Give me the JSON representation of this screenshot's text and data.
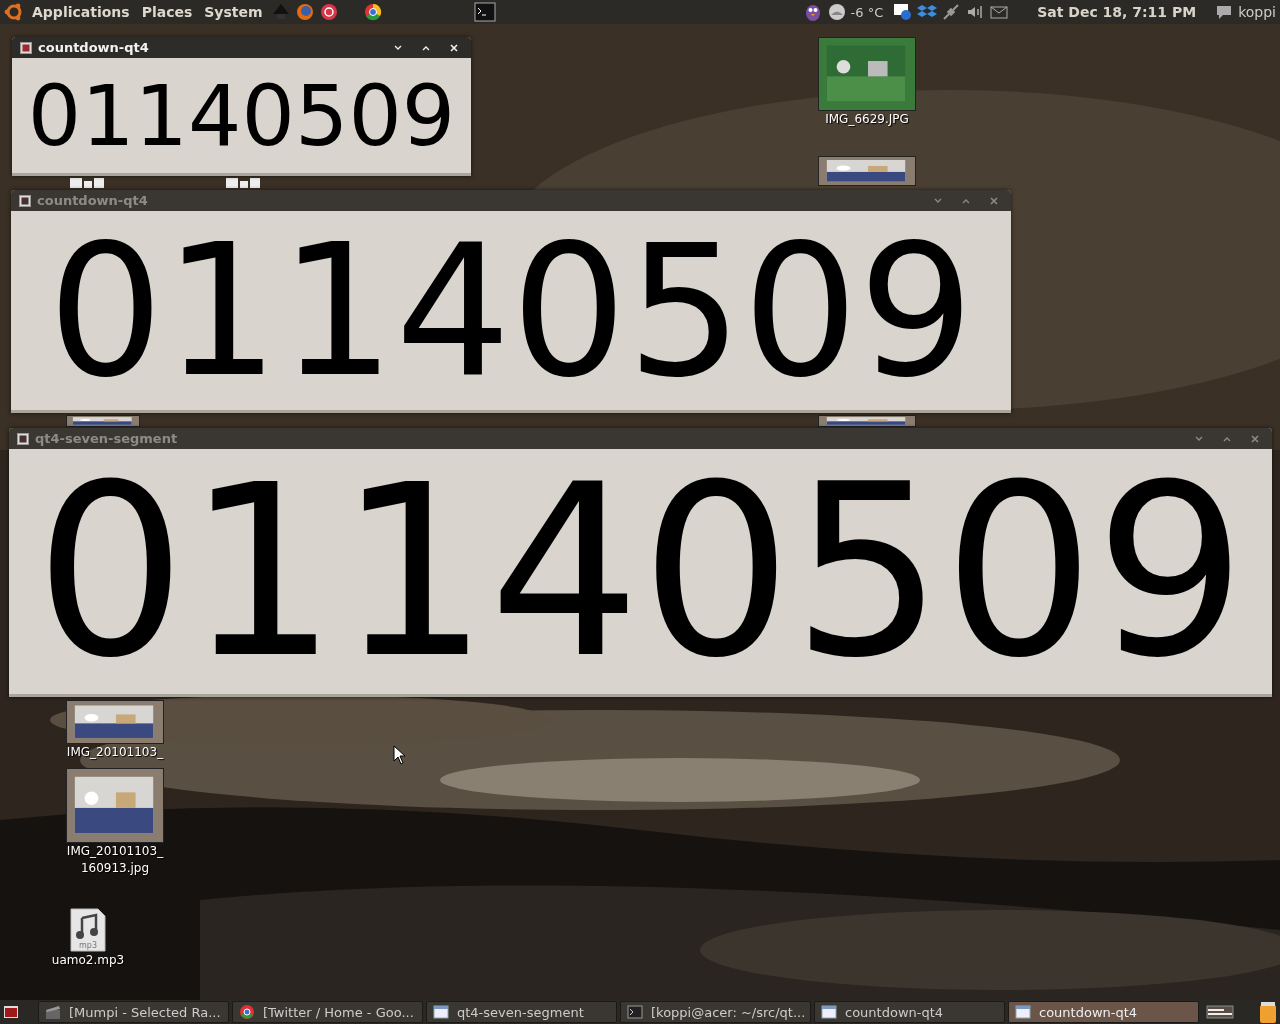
{
  "top_panel": {
    "menus": [
      "Applications",
      "Places",
      "System"
    ],
    "weather": "-6 °C",
    "clock": "Sat Dec 18,  7:11 PM",
    "user": "koppi"
  },
  "desktop_icons": [
    {
      "kind": "picture",
      "label": "IMG_6629.JPG"
    },
    {
      "kind": "picture"
    },
    {
      "kind": "picture"
    },
    {
      "kind": "picture"
    },
    {
      "kind": "picture",
      "lines": [
        "IMG_20101103_"
      ]
    },
    {
      "kind": "picture",
      "lines": [
        "IMG_20101103_",
        "160913.jpg"
      ]
    },
    {
      "kind": "audio",
      "badge": "mp3",
      "lines": [
        "uamo2.mp3"
      ]
    }
  ],
  "windows": [
    {
      "title": "countdown-qt4",
      "active": true,
      "display": "01140509"
    },
    {
      "title": "countdown-qt4",
      "active": false,
      "display": "01140509"
    },
    {
      "title": "qt4-seven-segment",
      "active": false,
      "display": "01140509"
    }
  ],
  "taskbar": [
    {
      "kind": "film",
      "label": "[Mumpi - Selected Ra...",
      "selected": false
    },
    {
      "kind": "browser",
      "label": "[Twitter / Home - Goo...",
      "selected": false
    },
    {
      "kind": "window",
      "label": "qt4-seven-segment",
      "selected": false
    },
    {
      "kind": "terminal",
      "label": "[koppi@acer: ~/src/qt...",
      "selected": false
    },
    {
      "kind": "window",
      "label": "countdown-qt4",
      "selected": false
    },
    {
      "kind": "window",
      "label": "countdown-qt4",
      "selected": true
    }
  ]
}
